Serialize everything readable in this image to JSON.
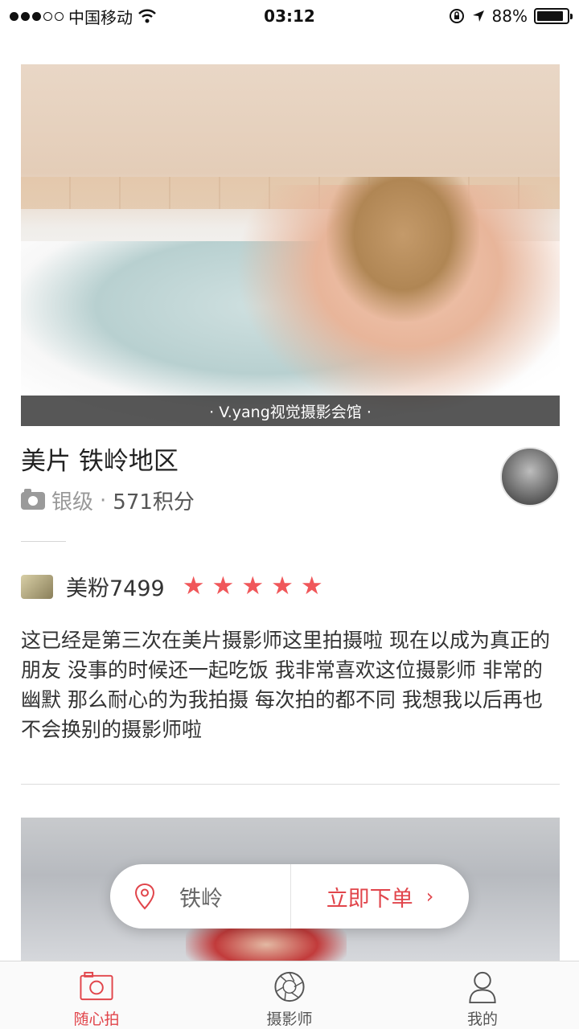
{
  "status_bar": {
    "carrier": "中国移动",
    "time": "03:12",
    "battery": "88%",
    "battery_level": 0.88
  },
  "card": {
    "caption": "· V.yang视觉摄影会馆 ·",
    "title": "美片 铁岭地区",
    "level": "银级",
    "separator": "·",
    "points": "571积分"
  },
  "review": {
    "reviewer": "美粉7499",
    "rating": 5,
    "text": "这已经是第三次在美片摄影师这里拍摄啦 现在以成为真正的朋友 没事的时候还一起吃饭 我非常喜欢这位摄影师 非常的幽默 那么耐心的为我拍摄 每次拍的都不同 我想我以后再也不会换别的摄影师啦"
  },
  "action": {
    "location": "铁岭",
    "order_label": "立即下单"
  },
  "tabs": [
    {
      "label": "随心拍",
      "icon": "camera-icon",
      "active": true
    },
    {
      "label": "摄影师",
      "icon": "aperture-icon",
      "active": false
    },
    {
      "label": "我的",
      "icon": "user-icon",
      "active": false
    }
  ],
  "colors": {
    "accent": "#e1454b",
    "star": "#f0575a"
  }
}
